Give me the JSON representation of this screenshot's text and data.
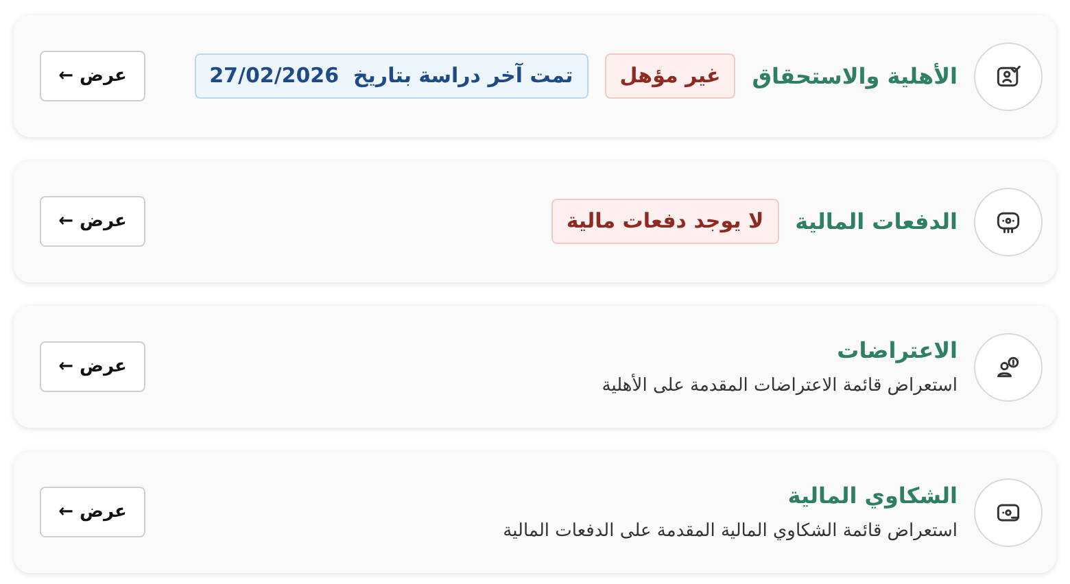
{
  "cards": [
    {
      "kind": "eligibility",
      "title": "الأهلية والاستحقاق",
      "badges": [
        {
          "kind": "danger",
          "text": "غير مؤهل"
        },
        {
          "kind": "info",
          "text": "تمت آخر دراسة بتاريخ  27/02/2026"
        }
      ],
      "button": "عرض ←"
    },
    {
      "kind": "payments",
      "title": "الدفعات المالية",
      "badges": [
        {
          "kind": "danger",
          "text": "لا يوجد دفعات مالية"
        }
      ],
      "button": "عرض ←"
    },
    {
      "kind": "objections",
      "title": "الاعتراضات",
      "description": "استعراض قائمة الاعتراضات المقدمة على الأهلية",
      "button": "عرض ←"
    },
    {
      "kind": "complaints",
      "title": "الشكاوي المالية",
      "description": "استعراض قائمة الشكاوي المالية المقدمة على الدفعات المالية",
      "button": "عرض ←"
    }
  ]
}
